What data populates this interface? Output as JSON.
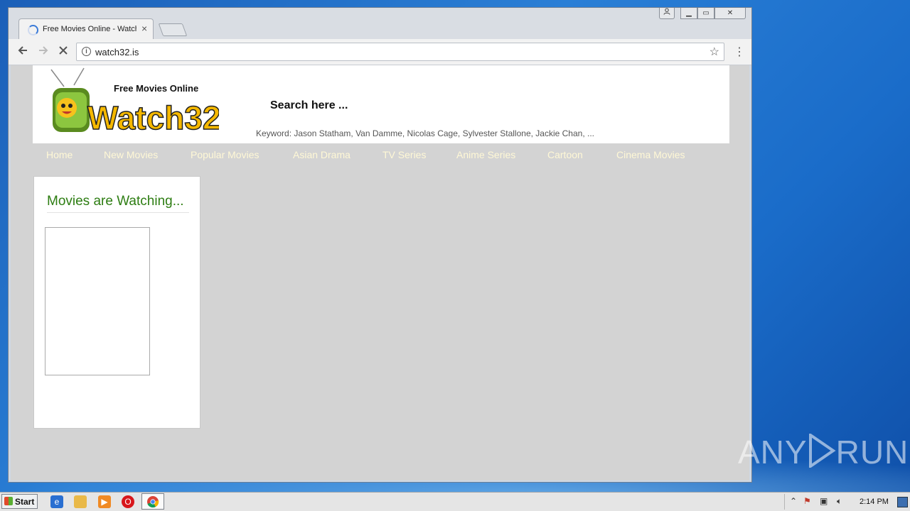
{
  "browser": {
    "tab_title": "Free Movies Online - Watch",
    "tab_close": "×",
    "url": "watch32.is",
    "window_buttons": {
      "minimize": "▁",
      "maximize": "▭",
      "close": "✕"
    }
  },
  "site": {
    "logo_tagline": "Free Movies Online",
    "logo_text": "Watch32",
    "search_label": "Search here ...",
    "keywords": "Keyword: Jason Statham, Van Damme, Nicolas Cage, Sylvester Stallone, Jackie Chan, ...",
    "nav": [
      "Home",
      "New Movies",
      "Popular Movies",
      "Asian Drama",
      "TV Series",
      "Anime Series",
      "Cartoon",
      "Cinema Movies"
    ],
    "sidebar_title": "Movies are Watching..."
  },
  "taskbar": {
    "start_label": "Start",
    "clock": "2:14 PM"
  },
  "watermark": {
    "left": "ANY",
    "right": "RUN"
  },
  "icons": {
    "back": "back-arrow-icon",
    "forward": "forward-arrow-icon",
    "stop": "stop-loading-icon",
    "info": "site-info-icon",
    "star": "bookmark-star-icon",
    "menu": "chrome-menu-icon"
  }
}
